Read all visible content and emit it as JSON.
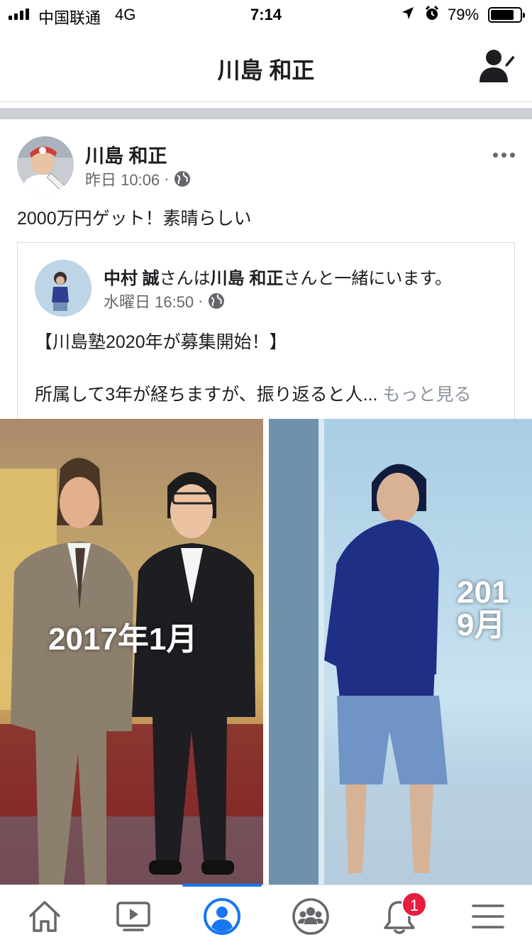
{
  "status_bar": {
    "carrier": "中国联通",
    "network": "4G",
    "time": "7:14",
    "battery_percent": "79%",
    "battery_level": 0.79
  },
  "header": {
    "title": "川島 和正",
    "edit_icon": "person-pencil-icon"
  },
  "post": {
    "author": "川島 和正",
    "timestamp": "昨日 10:06",
    "separator": "·",
    "privacy_icon": "globe-icon",
    "text": "2000万円ゲット！素晴らしい",
    "more_icon": "ellipsis-icon"
  },
  "shared_post": {
    "author": "中村 誠",
    "with_text_1": "さんは",
    "tagged": "川島 和正",
    "with_text_2": "さんと一緒にいます。",
    "timestamp": "水曜日 16:50",
    "separator": "·",
    "headline": "【川島塾2020年が募集開始！】",
    "body": "所属して3年が経ちますが、振り返ると人...",
    "see_more": "もっと見る"
  },
  "photos": [
    {
      "label": "2017年1月"
    },
    {
      "label_line1": "201",
      "label_line2": "9月"
    }
  ],
  "tab_bar": {
    "tabs": [
      {
        "icon": "home-icon"
      },
      {
        "icon": "video-icon"
      },
      {
        "icon": "profile-icon",
        "active": true
      },
      {
        "icon": "groups-icon"
      },
      {
        "icon": "bell-icon",
        "badge": "1"
      },
      {
        "icon": "menu-icon"
      }
    ],
    "accent_color": "#1877f2",
    "badge_color": "#e41e3f"
  }
}
